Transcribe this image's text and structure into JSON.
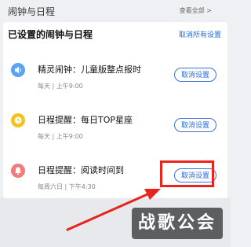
{
  "topbar": {
    "title": "闹钟与日程",
    "more_link": "查看全部 >"
  },
  "card": {
    "title": "已设置的闹钟与日程",
    "cancel_all": "取消所有设置",
    "items": [
      {
        "name": "精灵闹钟：儿童版整点报时",
        "schedule": "每天 | 上午9:00",
        "button": "取消设置",
        "icon": "speaker-icon",
        "icon_color": "#5aa3f2"
      },
      {
        "name": "日程提醒：每日TOP星座",
        "schedule": "每天 | 上午9:00",
        "button": "取消设置",
        "icon": "clock-icon",
        "icon_color": "#f4c21b"
      },
      {
        "name": "日程提醒：阅读时间到",
        "schedule": "每周六日 | 下午4:30",
        "button": "取消设置",
        "icon": "bell-icon",
        "icon_color": "#f07b7b"
      }
    ]
  },
  "colors": {
    "accent": "#2a6ae0",
    "highlight": "#e8241c"
  },
  "watermark": "战歌公会"
}
